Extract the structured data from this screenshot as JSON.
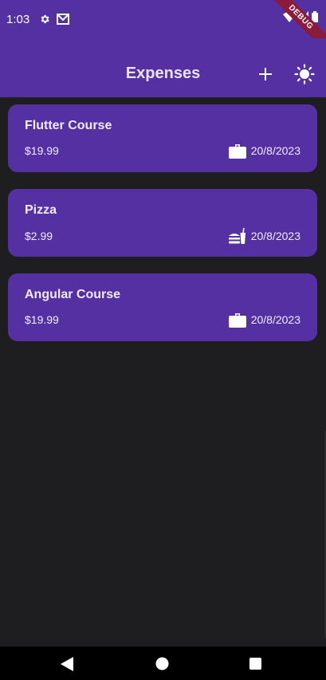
{
  "status_bar": {
    "time": "1:03",
    "icons": [
      "gear-icon",
      "gmail-icon",
      "wifi-icon",
      "signal-icon",
      "battery-icon"
    ]
  },
  "debug_banner": "DEBUG",
  "app_bar": {
    "title": "Expenses",
    "actions": [
      "add-icon",
      "brightness-icon"
    ]
  },
  "expenses": [
    {
      "title": "Flutter Course",
      "amount": "$19.99",
      "category_icon": "work-icon",
      "date": "20/8/2023"
    },
    {
      "title": "Pizza",
      "amount": "$2.99",
      "category_icon": "food-icon",
      "date": "20/8/2023"
    },
    {
      "title": "Angular Course",
      "amount": "$19.99",
      "category_icon": "work-icon",
      "date": "20/8/2023"
    }
  ],
  "nav_bar": {
    "buttons": [
      "back-icon",
      "home-icon",
      "recents-icon"
    ]
  },
  "colors": {
    "primary": "#5430a3",
    "background": "#1e1e20",
    "text": "#f1ecff",
    "ribbon": "#8a1b3a"
  }
}
